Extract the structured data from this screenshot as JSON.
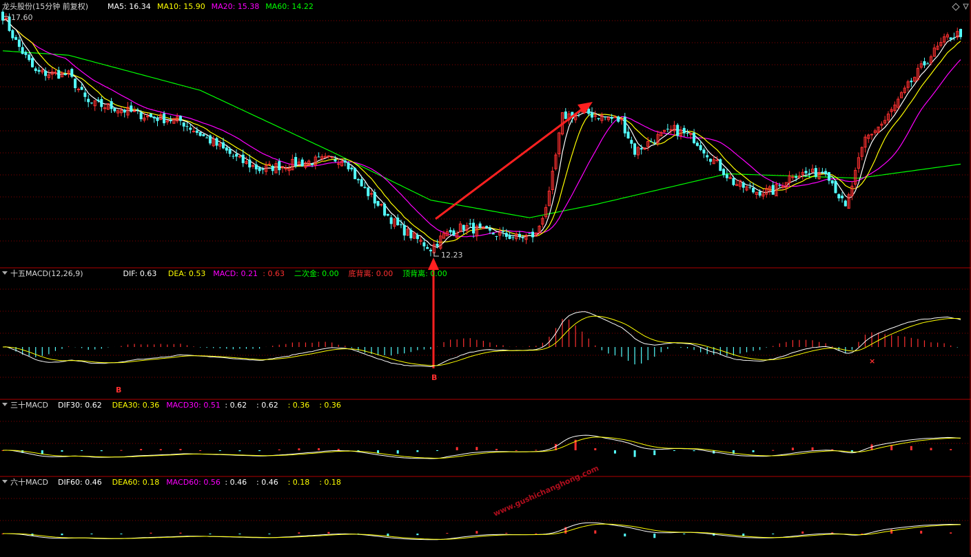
{
  "main": {
    "title": "龙头股份(15分钟 前复权)",
    "labels": [
      {
        "text": "MA5: 16.34",
        "color": "#ffffff"
      },
      {
        "text": "MA10: 15.90",
        "color": "#ffff00"
      },
      {
        "text": "MA20: 15.38",
        "color": "#ff00ff"
      },
      {
        "text": "MA60: 14.22",
        "color": "#00ff00"
      }
    ],
    "high_label": "17.60",
    "low_label": "12.23",
    "ylim": [
      12.0,
      17.8
    ]
  },
  "macd15": {
    "title": "十五MACD(12,26,9)",
    "labels": [
      {
        "text": "DIF: 0.63",
        "color": "#ffffff"
      },
      {
        "text": "DEA: 0.53",
        "color": "#ffff00"
      },
      {
        "text": "MACD: 0.21",
        "color": "#ff00ff"
      },
      {
        "text": ": 0.63",
        "color": "#ff3030"
      },
      {
        "text": "二次金: 0.00",
        "color": "#00ff00"
      },
      {
        "text": "底背离: 0.00",
        "color": "#ff3030"
      },
      {
        "text": "顶背离: 0.00",
        "color": "#00ff00"
      }
    ],
    "markers": [
      {
        "text": "B",
        "color": "#ff3030"
      },
      {
        "text": "B",
        "color": "#ff3030"
      },
      {
        "text": "×",
        "color": "#ff3030"
      }
    ]
  },
  "macd30": {
    "title": "三十MACD",
    "labels": [
      {
        "text": "DIF30: 0.62",
        "color": "#ffffff"
      },
      {
        "text": "DEA30: 0.36",
        "color": "#ffff00"
      },
      {
        "text": "MACD30: 0.51",
        "color": "#ff00ff"
      },
      {
        "text": ": 0.62",
        "color": "#ffffff"
      },
      {
        "text": ": 0.62",
        "color": "#ffffff"
      },
      {
        "text": ": 0.36",
        "color": "#ffff00"
      },
      {
        "text": ": 0.36",
        "color": "#ffff00"
      }
    ]
  },
  "macd60": {
    "title": "六十MACD",
    "labels": [
      {
        "text": "DIF60: 0.46",
        "color": "#ffffff"
      },
      {
        "text": "DEA60: 0.18",
        "color": "#ffff00"
      },
      {
        "text": "MACD60: 0.56",
        "color": "#ff00ff"
      },
      {
        "text": ": 0.46",
        "color": "#ffffff"
      },
      {
        "text": ": 0.46",
        "color": "#ffffff"
      },
      {
        "text": ": 0.18",
        "color": "#ffff00"
      },
      {
        "text": ": 0.18",
        "color": "#ffff00"
      }
    ]
  },
  "watermark": "www.gushichanghong.com",
  "colors": {
    "up": "#ff3030",
    "down": "#54ffff",
    "ma5": "#ffffff",
    "ma10": "#ffff00",
    "ma20": "#ff00ff",
    "ma60": "#00ff00",
    "grid": "#8b0000",
    "border": "#b00000",
    "arrow": "#ff2020",
    "watermark": "#c01020"
  },
  "chart_data": {
    "type": "candlestick",
    "title": "龙头股份(15分钟 前复权)",
    "close_path": [
      [
        0,
        17.6
      ],
      [
        4,
        17.0
      ],
      [
        10,
        16.3
      ],
      [
        20,
        16.25
      ],
      [
        26,
        15.6
      ],
      [
        34,
        15.5
      ],
      [
        44,
        15.3
      ],
      [
        54,
        15.2
      ],
      [
        60,
        14.9
      ],
      [
        66,
        14.6
      ],
      [
        72,
        14.3
      ],
      [
        78,
        14.1
      ],
      [
        86,
        14.2
      ],
      [
        96,
        14.3
      ],
      [
        104,
        14.35
      ],
      [
        108,
        13.8
      ],
      [
        114,
        13.3
      ],
      [
        120,
        12.8
      ],
      [
        126,
        12.5
      ],
      [
        130,
        12.3
      ],
      [
        134,
        12.6
      ],
      [
        140,
        12.8
      ],
      [
        148,
        12.65
      ],
      [
        156,
        12.55
      ],
      [
        162,
        12.6
      ],
      [
        166,
        13.5
      ],
      [
        170,
        15.3
      ],
      [
        176,
        15.4
      ],
      [
        182,
        15.3
      ],
      [
        188,
        15.2
      ],
      [
        192,
        14.5
      ],
      [
        198,
        14.8
      ],
      [
        204,
        15.0
      ],
      [
        210,
        14.8
      ],
      [
        216,
        14.3
      ],
      [
        222,
        13.8
      ],
      [
        228,
        13.6
      ],
      [
        234,
        13.6
      ],
      [
        240,
        14.0
      ],
      [
        246,
        14.0
      ],
      [
        250,
        14.1
      ],
      [
        256,
        13.2
      ],
      [
        262,
        14.8
      ],
      [
        268,
        15.2
      ],
      [
        276,
        16.1
      ],
      [
        282,
        16.7
      ],
      [
        287,
        17.1
      ],
      [
        291,
        17.2
      ]
    ],
    "ma_lines": [
      {
        "name": "MA5",
        "value": 16.34
      },
      {
        "name": "MA10",
        "value": 15.9
      },
      {
        "name": "MA20",
        "value": 15.38
      },
      {
        "name": "MA60",
        "value": 14.22
      }
    ],
    "ma60_path": [
      [
        0,
        16.8
      ],
      [
        20,
        16.7
      ],
      [
        60,
        15.9
      ],
      [
        100,
        14.5
      ],
      [
        130,
        13.4
      ],
      [
        160,
        13.0
      ],
      [
        180,
        13.3
      ],
      [
        220,
        14.0
      ],
      [
        260,
        13.9
      ],
      [
        291,
        14.22
      ]
    ],
    "annotations": {
      "high": 17.6,
      "low": 12.23
    },
    "ylim": [
      12.0,
      17.8
    ],
    "panels": [
      {
        "name": "十五MACD",
        "dif": 0.63,
        "dea": 0.53,
        "macd": 0.21
      },
      {
        "name": "三十MACD",
        "dif": 0.62,
        "dea": 0.36,
        "macd": 0.51
      },
      {
        "name": "六十MACD",
        "dif": 0.46,
        "dea": 0.18,
        "macd": 0.56
      }
    ]
  }
}
